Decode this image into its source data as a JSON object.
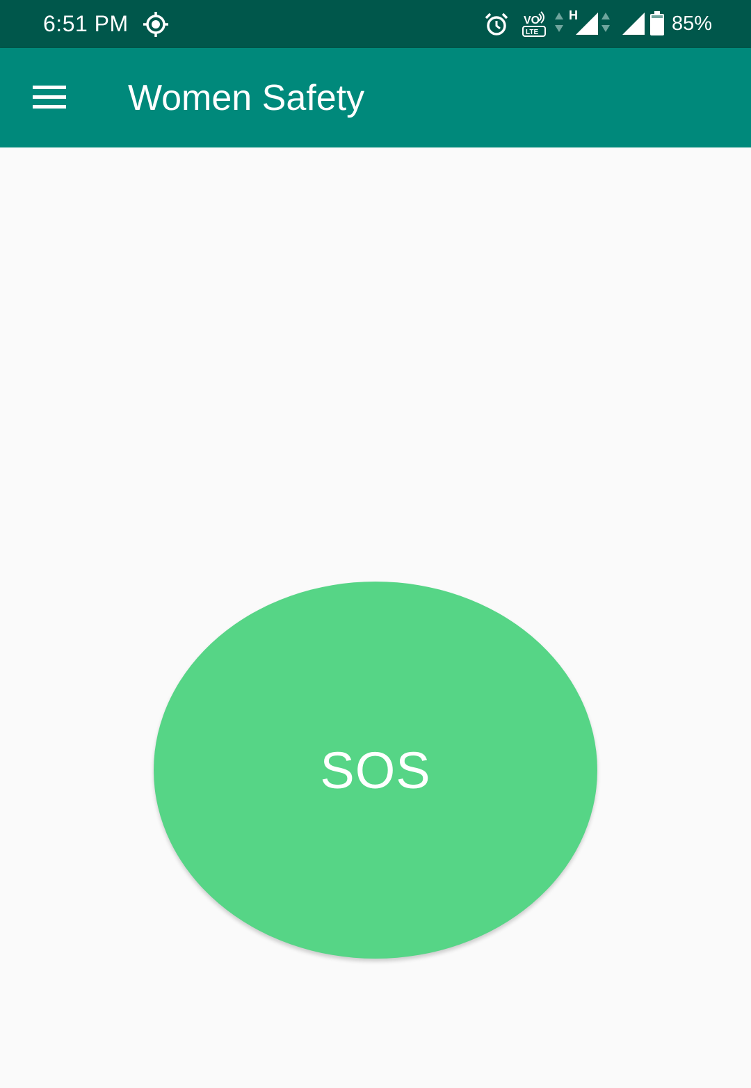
{
  "status_bar": {
    "time": "6:51 PM",
    "battery_percent": "85%",
    "network_type": "H",
    "volte_label": "VO",
    "lte_label": "LTE",
    "icons": [
      "location-icon",
      "alarm-icon",
      "volte-icon",
      "signal-icon",
      "battery-icon"
    ],
    "background_color": "#00574b"
  },
  "app_bar": {
    "title": "Women Safety",
    "background_color": "#00897b",
    "menu_icon": "hamburger-menu-icon"
  },
  "main": {
    "sos_label": "SOS",
    "sos_color": "#56d586"
  }
}
